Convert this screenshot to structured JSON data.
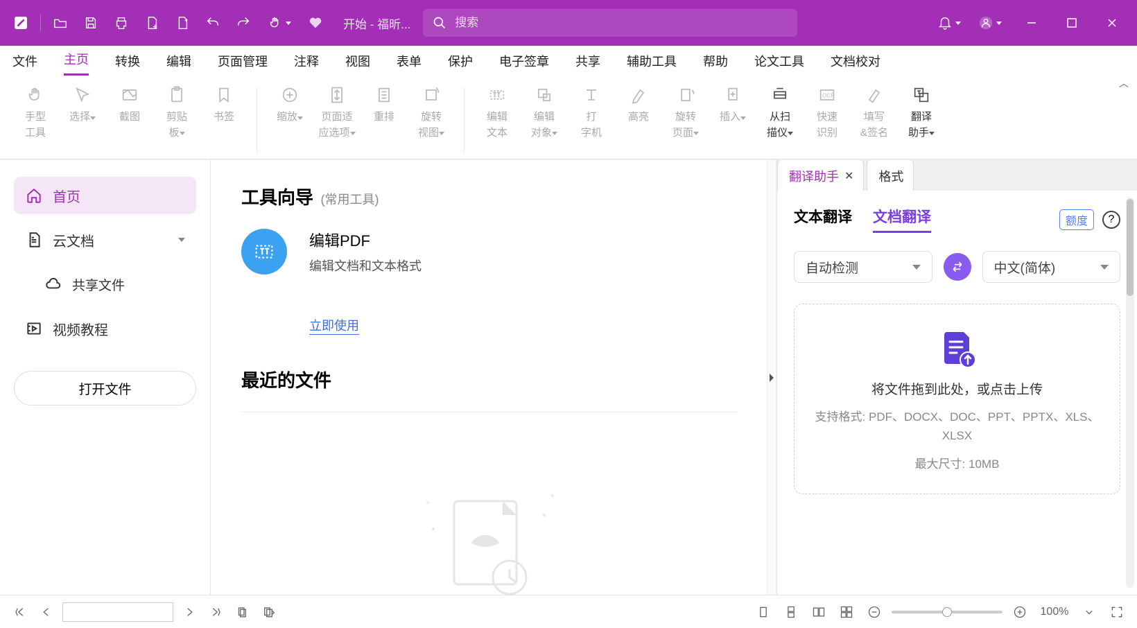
{
  "titlebar": {
    "doc_title": "开始 - 福昕...",
    "search_placeholder": "搜索"
  },
  "menubar": {
    "items": [
      "文件",
      "主页",
      "转换",
      "编辑",
      "页面管理",
      "注释",
      "视图",
      "表单",
      "保护",
      "电子签章",
      "共享",
      "辅助工具",
      "帮助",
      "论文工具",
      "文档校对"
    ],
    "active_index": 1
  },
  "ribbon": {
    "items": [
      {
        "label1": "手型",
        "label2": "工具",
        "arrow": false,
        "dark": false
      },
      {
        "label1": "选择",
        "label2": "",
        "arrow": true,
        "dark": false
      },
      {
        "label1": "截图",
        "label2": "",
        "arrow": false,
        "dark": false
      },
      {
        "label1": "剪贴",
        "label2": "板",
        "arrow": true,
        "dark": false
      },
      {
        "label1": "书签",
        "label2": "",
        "arrow": false,
        "dark": false
      }
    ],
    "items2": [
      {
        "label1": "缩放",
        "label2": "",
        "arrow": true,
        "dark": false
      },
      {
        "label1": "页面适",
        "label2": "应选项",
        "arrow": true,
        "dark": false
      },
      {
        "label1": "重排",
        "label2": "",
        "arrow": false,
        "dark": false
      },
      {
        "label1": "旋转",
        "label2": "视图",
        "arrow": true,
        "dark": false
      }
    ],
    "items3": [
      {
        "label1": "编辑",
        "label2": "文本",
        "arrow": false,
        "dark": false
      },
      {
        "label1": "编辑",
        "label2": "对象",
        "arrow": true,
        "dark": false
      },
      {
        "label1": "打",
        "label2": "字机",
        "arrow": false,
        "dark": false
      },
      {
        "label1": "高亮",
        "label2": "",
        "arrow": false,
        "dark": false
      },
      {
        "label1": "旋转",
        "label2": "页面",
        "arrow": true,
        "dark": false
      },
      {
        "label1": "插入",
        "label2": "",
        "arrow": true,
        "dark": false
      },
      {
        "label1": "从扫",
        "label2": "描仪",
        "arrow": true,
        "dark": true
      },
      {
        "label1": "快速",
        "label2": "识别",
        "arrow": false,
        "dark": false
      },
      {
        "label1": "填写",
        "label2": "&签名",
        "arrow": false,
        "dark": false
      },
      {
        "label1": "翻译",
        "label2": "助手",
        "arrow": true,
        "dark": true
      }
    ]
  },
  "sidebar": {
    "home": "首页",
    "cloud": "云文档",
    "shared": "共享文件",
    "video": "视频教程",
    "open_btn": "打开文件"
  },
  "center": {
    "guide_title": "工具向导",
    "guide_sub": "(常用工具)",
    "tool_title": "编辑PDF",
    "tool_desc": "编辑文档和文本格式",
    "tool_link": "立即使用",
    "recent_title": "最近的文件"
  },
  "rightpanel": {
    "tab1": "翻译助手",
    "tab2": "格式",
    "subtab1": "文本翻译",
    "subtab2": "文档翻译",
    "quota": "额度",
    "lang_from": "自动检测",
    "lang_to": "中文(简体)",
    "drop_title": "将文件拖到此处，或点击上传",
    "drop_formats": "支持格式: PDF、DOCX、DOC、PPT、PPTX、XLS、XLSX",
    "drop_size": "最大尺寸: 10MB"
  },
  "statusbar": {
    "zoom": "100%"
  }
}
